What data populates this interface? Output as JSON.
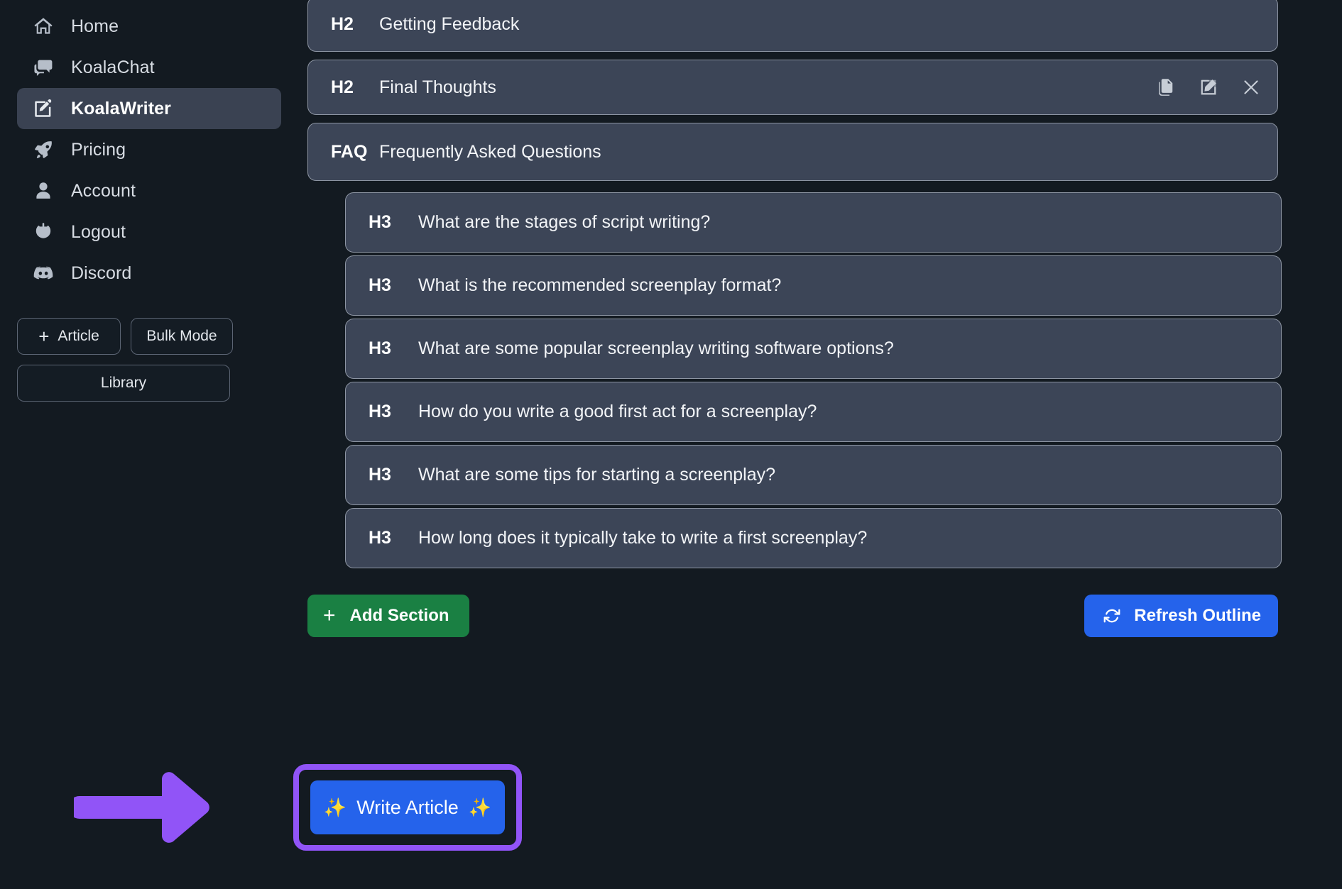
{
  "sidebar": {
    "items": [
      {
        "label": "Home",
        "icon": "home-icon",
        "active": false
      },
      {
        "label": "KoalaChat",
        "icon": "chat-icon",
        "active": false
      },
      {
        "label": "KoalaWriter",
        "icon": "pencil-square-icon",
        "active": true
      },
      {
        "label": "Pricing",
        "icon": "rocket-icon",
        "active": false
      },
      {
        "label": "Account",
        "icon": "user-icon",
        "active": false
      },
      {
        "label": "Logout",
        "icon": "power-icon",
        "active": false
      },
      {
        "label": "Discord",
        "icon": "discord-icon",
        "active": false
      }
    ],
    "buttons": {
      "article": "Article",
      "article_plus": "+",
      "bulk_mode": "Bulk Mode",
      "library": "Library"
    }
  },
  "outline": {
    "sections": [
      {
        "tag": "H2",
        "title": "Getting Feedback",
        "level": "h2",
        "actions": false
      },
      {
        "tag": "H2",
        "title": "Final Thoughts",
        "level": "h2",
        "actions": true
      },
      {
        "tag": "FAQ",
        "title": "Frequently Asked Questions",
        "level": "h2",
        "actions": false
      },
      {
        "tag": "H3",
        "title": "What are the stages of script writing?",
        "level": "h3",
        "actions": false
      },
      {
        "tag": "H3",
        "title": "What is the recommended screenplay format?",
        "level": "h3",
        "actions": false
      },
      {
        "tag": "H3",
        "title": "What are some popular screenplay writing software options?",
        "level": "h3",
        "actions": false
      },
      {
        "tag": "H3",
        "title": "How do you write a good first act for a screenplay?",
        "level": "h3",
        "actions": false
      },
      {
        "tag": "H3",
        "title": "What are some tips for starting a screenplay?",
        "level": "h3",
        "actions": false
      },
      {
        "tag": "H3",
        "title": "How long does it typically take to write a first screenplay?",
        "level": "h3",
        "actions": false
      }
    ],
    "row_actions": {
      "duplicate": "duplicate-icon",
      "edit": "edit-icon",
      "remove": "close-icon"
    }
  },
  "actions": {
    "add_section": "Add Section",
    "add_section_plus": "+",
    "refresh_outline": "Refresh Outline",
    "write_article": "Write Article",
    "sparkle_left": "✨",
    "sparkle_right": "✨"
  },
  "colors": {
    "page_bg": "#131a21",
    "row_bg": "#3c4557",
    "row_border": "#8d95a3",
    "sidebar_active": "#3a4252",
    "green": "#1a8043",
    "blue": "#2563eb",
    "purple_highlight": "#9154f7"
  }
}
